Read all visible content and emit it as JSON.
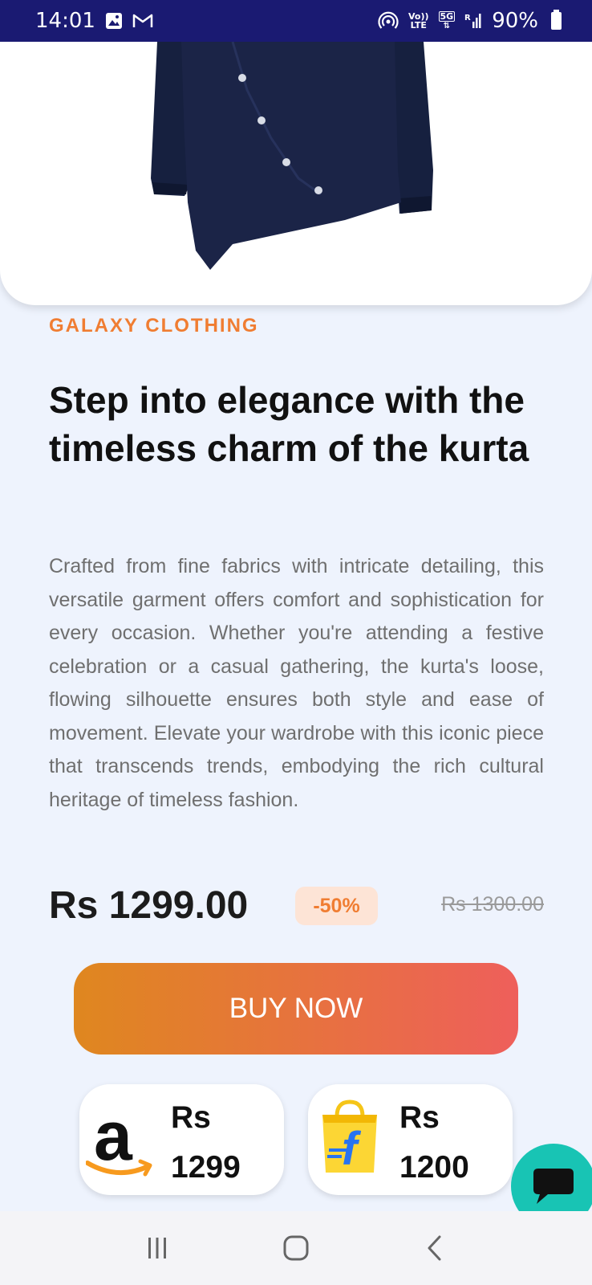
{
  "status_bar": {
    "time": "14:01",
    "volte_line1": "Vo))",
    "volte_line2": "LTE",
    "network": "5G",
    "battery": "90%"
  },
  "product": {
    "brand": "GALAXY CLOTHING",
    "title": "Step into elegance with the timeless charm of the kurta",
    "description": "Crafted from fine fabrics with intricate detailing, this versatile garment offers comfort and sophistication for every occasion. Whether you're attending a festive celebration or a casual gathering, the kurta's loose, flowing silhouette ensures both style and ease of movement. Elevate your wardrobe with this iconic piece that transcends trends, embodying the rich cultural heritage of timeless fashion.",
    "price": "Rs 1299.00",
    "discount": "-50%",
    "old_price": "Rs 1300.00",
    "buy_label": "BUY NOW"
  },
  "stores": [
    {
      "logo": "amazon-logo-icon",
      "currency": "Rs",
      "price": "1299"
    },
    {
      "logo": "flipkart-logo-icon",
      "currency": "Rs",
      "price": "1200"
    }
  ],
  "colors": {
    "accent": "#f07d32",
    "gradient_start": "#df871f",
    "gradient_end": "#ee5f5b",
    "status_bar": "#1a1a72",
    "chat_fab": "#18c4b4",
    "background": "#eef3fd"
  },
  "icons": {
    "chat": "chat-bubble-icon",
    "nav_recents": "recents-icon",
    "nav_home": "home-icon",
    "nav_back": "back-icon"
  }
}
